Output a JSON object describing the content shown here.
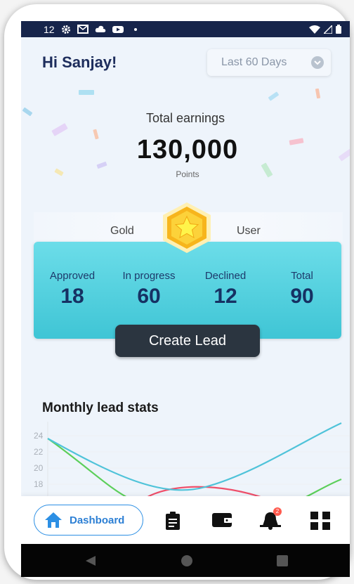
{
  "status_bar": {
    "time": "12"
  },
  "header": {
    "greeting": "Hi Sanjay!",
    "range": "Last 60 Days"
  },
  "earnings": {
    "label": "Total earnings",
    "value": "130,000",
    "unit": "Points"
  },
  "tier": {
    "left": "Gold",
    "right": "User"
  },
  "stats": [
    {
      "label": "Approved",
      "value": "18"
    },
    {
      "label": "In progress",
      "value": "60"
    },
    {
      "label": "Declined",
      "value": "12"
    },
    {
      "label": "Total",
      "value": "90"
    }
  ],
  "create_lead": "Create Lead",
  "monthly": {
    "title": "Monthly lead stats",
    "y_ticks": [
      "24",
      "22",
      "20",
      "18"
    ]
  },
  "chart_data": {
    "type": "line",
    "yticks": [
      24,
      22,
      20,
      18
    ],
    "colors": [
      "#4fc3d9",
      "#5ccf5a",
      "#ef4f6a"
    ]
  },
  "bottom_nav": {
    "dashboard": "Dashboard",
    "notification_count": "2"
  },
  "colors": {
    "accent": "#2c8fe4",
    "card": "#4fcfdd",
    "dark_button": "#2b3540",
    "status_bar": "#17254b"
  }
}
